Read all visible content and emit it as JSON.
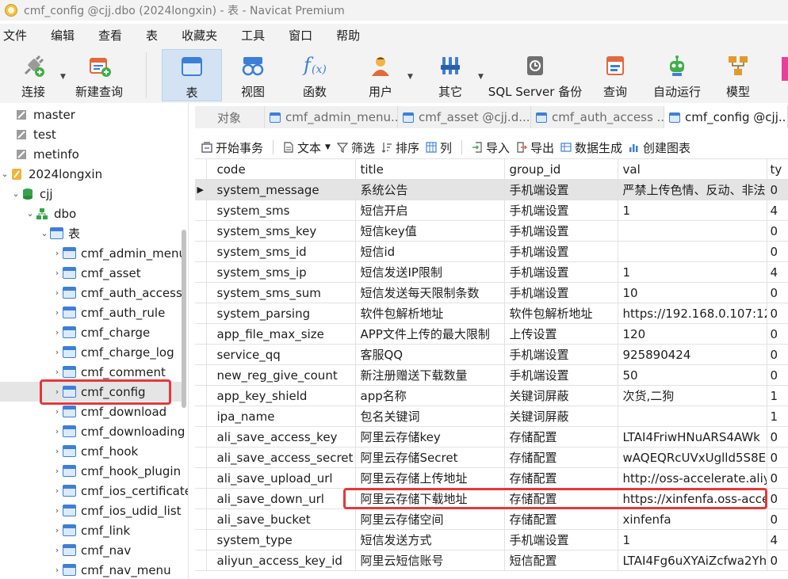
{
  "window": {
    "title": "cmf_config @cjj.dbo (2024longxin) - 表 - Navicat Premium"
  },
  "menu": [
    "文件",
    "编辑",
    "查看",
    "表",
    "收藏夹",
    "工具",
    "窗口",
    "帮助"
  ],
  "toolbar": {
    "connect": "连接",
    "new_query": "新建查询",
    "table": "表",
    "view": "视图",
    "function": "函数",
    "user": "用户",
    "other": "其它",
    "backup": "SQL Server 备份",
    "query": "查询",
    "auto_run": "自动运行",
    "model": "模型"
  },
  "tree": [
    {
      "label": "master",
      "icon": "database-icon",
      "level": 0
    },
    {
      "label": "test",
      "icon": "database-icon",
      "level": 0
    },
    {
      "label": "metinfo",
      "icon": "database-icon",
      "level": 0
    },
    {
      "label": "2024longxin",
      "icon": "connection-icon",
      "level": 0
    },
    {
      "label": "cjj",
      "icon": "database-icon",
      "level": 1
    },
    {
      "label": "dbo",
      "icon": "schema-icon",
      "level": 2
    },
    {
      "label": "表",
      "icon": "table-icon",
      "level": 3
    },
    {
      "label": "cmf_admin_menu",
      "icon": "table-icon",
      "level": 4
    },
    {
      "label": "cmf_asset",
      "icon": "table-icon",
      "level": 4
    },
    {
      "label": "cmf_auth_access",
      "icon": "table-icon",
      "level": 4
    },
    {
      "label": "cmf_auth_rule",
      "icon": "table-icon",
      "level": 4
    },
    {
      "label": "cmf_charge",
      "icon": "table-icon",
      "level": 4
    },
    {
      "label": "cmf_charge_log",
      "icon": "table-icon",
      "level": 4
    },
    {
      "label": "cmf_comment",
      "icon": "table-icon",
      "level": 4
    },
    {
      "label": "cmf_config",
      "icon": "table-icon",
      "level": 4
    },
    {
      "label": "cmf_download",
      "icon": "table-icon",
      "level": 4
    },
    {
      "label": "cmf_downloading",
      "icon": "table-icon",
      "level": 4
    },
    {
      "label": "cmf_hook",
      "icon": "table-icon",
      "level": 4
    },
    {
      "label": "cmf_hook_plugin",
      "icon": "table-icon",
      "level": 4
    },
    {
      "label": "cmf_ios_certificate",
      "icon": "table-icon",
      "level": 4
    },
    {
      "label": "cmf_ios_udid_list",
      "icon": "table-icon",
      "level": 4
    },
    {
      "label": "cmf_link",
      "icon": "table-icon",
      "level": 4
    },
    {
      "label": "cmf_nav",
      "icon": "table-icon",
      "level": 4
    },
    {
      "label": "cmf_nav_menu",
      "icon": "table-icon",
      "level": 4
    }
  ],
  "tabs": [
    {
      "label": "对象",
      "icon": ""
    },
    {
      "label": "cmf_admin_menu...",
      "icon": "table-icon"
    },
    {
      "label": "cmf_asset @cjj.d...",
      "icon": "table-icon"
    },
    {
      "label": "cmf_auth_access ...",
      "icon": "table-icon"
    },
    {
      "label": "cmf_config @cjj....",
      "icon": "table-icon"
    }
  ],
  "object_toolbar": {
    "begin_transaction": "开始事务",
    "text": "文本",
    "filter": "筛选",
    "sort": "排序",
    "columns": "列",
    "import": "导入",
    "export": "导出",
    "data_gen": "数据生成",
    "create_chart": "创建图表"
  },
  "grid": {
    "columns": [
      "code",
      "title",
      "group_id",
      "val",
      "ty"
    ],
    "rows": [
      [
        "system_message",
        "系统公告",
        "手机端设置",
        "严禁上传色情、反动、非法",
        "0"
      ],
      [
        "system_sms",
        "短信开启",
        "手机端设置",
        "1",
        "4"
      ],
      [
        "system_sms_key",
        "短信key值",
        "手机端设置",
        "",
        "0"
      ],
      [
        "system_sms_id",
        "短信id",
        "手机端设置",
        "",
        "0"
      ],
      [
        "system_sms_ip",
        "短信发送IP限制",
        "手机端设置",
        "1",
        "4"
      ],
      [
        "system_sms_sum",
        "短信发送每天限制条数",
        "手机端设置",
        "10",
        "0"
      ],
      [
        "system_parsing",
        "软件包解析地址",
        "软件包解析地址",
        "https://192.168.0.107:12",
        "0"
      ],
      [
        "app_file_max_size",
        "APP文件上传的最大限制",
        "上传设置",
        "120",
        "0"
      ],
      [
        "service_qq",
        "客服QQ",
        "手机端设置",
        "925890424",
        "0"
      ],
      [
        "new_reg_give_count",
        "新注册赠送下载数量",
        "手机端设置",
        "50",
        "0"
      ],
      [
        "app_key_shield",
        "app名称",
        "关键词屏蔽",
        "次货,二狗",
        "1"
      ],
      [
        "ipa_name",
        "包名关键词",
        "关键词屏蔽",
        "",
        "1"
      ],
      [
        "ali_save_access_key",
        "阿里云存储key",
        "存储配置",
        "LTAI4FriwHNuARS4AWk",
        "0"
      ],
      [
        "ali_save_access_secret",
        "阿里云存储Secret",
        "存储配置",
        "wAQEQRcUVxUglld5S8E",
        "0"
      ],
      [
        "ali_save_upload_url",
        "阿里云存储上传地址",
        "存储配置",
        "http://oss-accelerate.aliy",
        "0"
      ],
      [
        "ali_save_down_url",
        "阿里云存储下载地址",
        "存储配置",
        "https://xinfenfa.oss-acce",
        "0"
      ],
      [
        "ali_save_bucket",
        "阿里云存储空间",
        "存储配置",
        "xinfenfa",
        "0"
      ],
      [
        "system_type",
        "短信发送方式",
        "手机端设置",
        "1",
        "4"
      ],
      [
        "aliyun_access_key_id",
        "阿里云短信账号",
        "短信配置",
        "LTAI4Fg6uXYAiZcfwa2Yh",
        "0"
      ]
    ],
    "current_row_marker": "▶"
  },
  "colors": {
    "highlight": "#e5373b",
    "active_tool": "#d3e3f3",
    "table_icon": "#3d7fd6"
  }
}
